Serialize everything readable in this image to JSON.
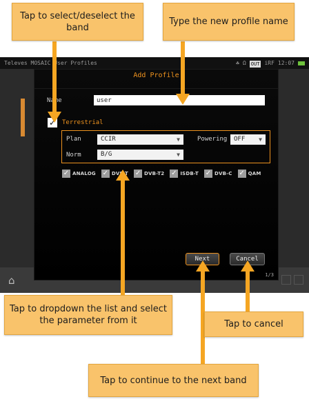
{
  "topbar": {
    "left_text": "Televes MOSAIC  User Profiles",
    "indicators": [
      "☘",
      "Ω"
    ],
    "out_label": "OUT",
    "rf_label": "iRF",
    "time": "12:07"
  },
  "dialog": {
    "title": "Add Profile",
    "name_label": "Name",
    "name_value": "user",
    "terrestrial_label": "Terrestrial",
    "terrestrial_checked": true,
    "plan_label": "Plan",
    "plan_value": "CCIR",
    "powering_label": "Powering",
    "powering_value": "OFF",
    "norm_label": "Norm",
    "norm_value": "B/G",
    "standards": [
      {
        "label": "ANALOG",
        "checked": true
      },
      {
        "label": "DVB-T",
        "checked": true
      },
      {
        "label": "DVB-T2",
        "checked": true
      },
      {
        "label": "ISDB-T",
        "checked": true
      },
      {
        "label": "DVB-C",
        "checked": true
      },
      {
        "label": "QAM",
        "checked": true
      }
    ],
    "next_label": "Next",
    "cancel_label": "Cancel",
    "page_indicator": "1/3"
  },
  "callouts": {
    "select_band": "Tap to select/deselect the band",
    "profile_name": "Type the new profile name",
    "dropdown": "Tap to dropdown the list and select the parameter from it",
    "cancel": "Tap to cancel",
    "next": "Tap to continue to the next band"
  },
  "colors": {
    "accent": "#f0941f",
    "callout_fill": "#f9c36b",
    "arrow": "#f5a623",
    "dialog_bg": "#000000",
    "screen_bg": "#2b2b2b"
  },
  "icons": {
    "home": "home-icon",
    "check": "checkmark-icon",
    "dropdown": "chevron-down-icon"
  }
}
